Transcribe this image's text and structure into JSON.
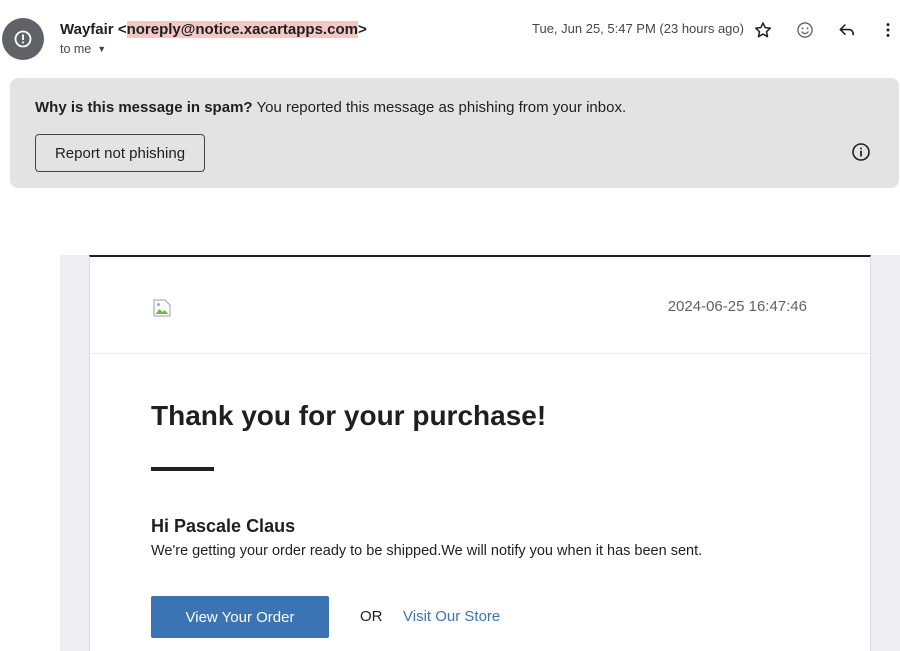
{
  "header": {
    "avatar_icon": "alert-circle-icon",
    "sender_name": "Wayfair",
    "sender_email_prefix": "<",
    "sender_email": "noreply@notice.xacartapps.com",
    "sender_email_suffix": ">",
    "to_label": "to me",
    "timestamp": "Tue, Jun 25, 5:47 PM (23 hours ago)",
    "icons": [
      "star-icon",
      "emoji-icon",
      "reply-icon",
      "more-vert-icon"
    ]
  },
  "spam_banner": {
    "question": "Why is this message in spam?",
    "explanation": " You reported this message as phishing from your inbox.",
    "report_button_label": "Report not phishing",
    "info_icon": "info-icon"
  },
  "email": {
    "logo_icon": "broken-image-icon",
    "date": "2024-06-25 16:47:46",
    "headline": "Thank you for your purchase!",
    "greeting": "Hi Pascale Claus",
    "body": "We're getting your order ready to be shipped.We will notify you when it has been sent.",
    "view_order_label": "View Your Order",
    "or_label": "OR",
    "store_link_label": "Visit Our Store",
    "colors": {
      "accent": "#3b74b4",
      "highlight": "#f4c7c3"
    }
  }
}
